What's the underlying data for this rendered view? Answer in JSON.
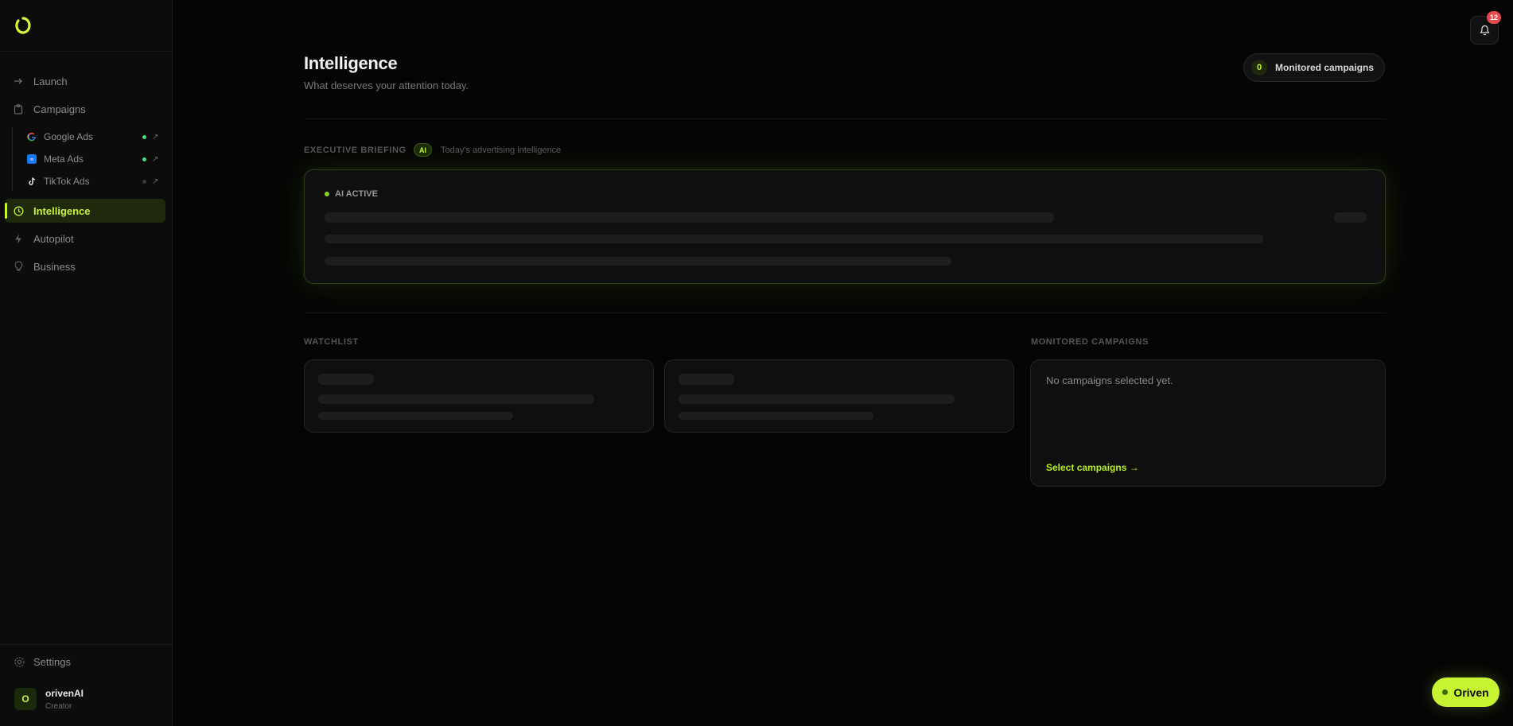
{
  "sidebar": {
    "nav": [
      {
        "label": "Launch",
        "icon": "arrow-right-icon"
      },
      {
        "label": "Campaigns",
        "icon": "clipboard-icon"
      },
      {
        "label": "Intelligence",
        "icon": "clock-icon"
      },
      {
        "label": "Autopilot",
        "icon": "bolt-icon"
      },
      {
        "label": "Business",
        "icon": "bulb-icon"
      }
    ],
    "campaign_items": [
      {
        "label": "Google Ads",
        "status": "connected"
      },
      {
        "label": "Meta Ads",
        "status": "connected"
      },
      {
        "label": "TikTok Ads",
        "status": "disconnected"
      }
    ],
    "settings_label": "Settings",
    "user": {
      "initial": "O",
      "name": "orivenAI",
      "role": "Creator"
    }
  },
  "header": {
    "title": "Intelligence",
    "subtitle": "What deserves your attention today.",
    "monitored_count": "0",
    "monitored_label": "Monitored campaigns",
    "notification_count": "12"
  },
  "briefing": {
    "label": "EXECUTIVE BRIEFING",
    "chip": "AI",
    "subtitle": "Today's advertising intelligence",
    "status": "AI ACTIVE"
  },
  "watchlist": {
    "label": "WATCHLIST"
  },
  "monitored": {
    "label": "MONITORED CAMPAIGNS",
    "empty_text": "No campaigns selected yet.",
    "link": "Select campaigns →"
  },
  "assistant_button": "Oriven",
  "colors": {
    "accent": "#c6f432",
    "background": "#050505",
    "status_green": "#4ade80",
    "badge_red": "#e5484d"
  }
}
